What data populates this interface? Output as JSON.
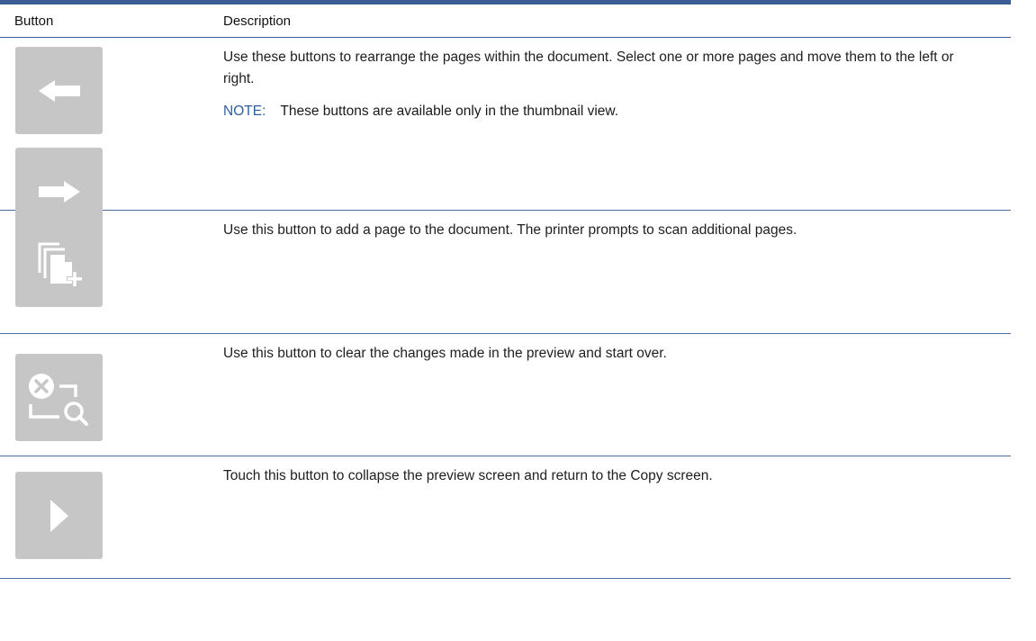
{
  "header": {
    "col_button": "Button",
    "col_description": "Description"
  },
  "rows": [
    {
      "icons": [
        "arrow-left-icon",
        "arrow-right-icon"
      ],
      "text": "Use these buttons to rearrange the pages within the document. Select one or more pages and move them to the left or right.",
      "note_label": "NOTE:",
      "note_text": "These buttons are available only in the thumbnail view."
    },
    {
      "icons": [
        "add-page-icon"
      ],
      "text": "Use this button to add a page to the document. The printer prompts to scan additional pages."
    },
    {
      "icons": [
        "clear-preview-icon"
      ],
      "text": "Use this button to clear the changes made in the preview and start over."
    },
    {
      "icons": [
        "play-collapse-icon"
      ],
      "text": "Touch this button to collapse the preview screen and return to the Copy screen."
    }
  ],
  "colors": {
    "rule": "#3a5e93",
    "button_bg": "#c6c6c6",
    "icon_fg": "#ffffff",
    "note_label": "#2f5f9a"
  }
}
